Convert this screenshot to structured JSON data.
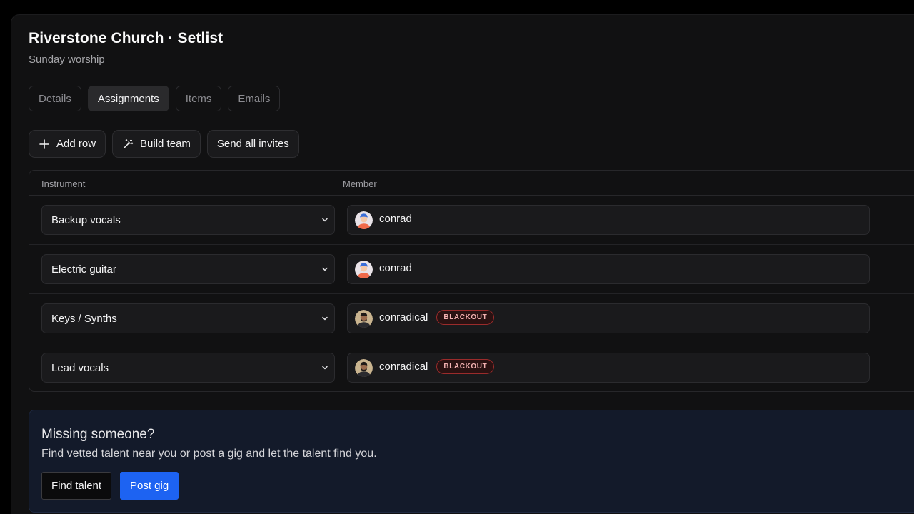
{
  "header": {
    "title": "Riverstone Church · Setlist",
    "subtitle": "Sunday worship"
  },
  "tabs": [
    {
      "label": "Details",
      "active": false
    },
    {
      "label": "Assignments",
      "active": true
    },
    {
      "label": "Items",
      "active": false
    },
    {
      "label": "Emails",
      "active": false
    }
  ],
  "actions": {
    "add_row": "Add row",
    "build_team": "Build team",
    "send_invites": "Send all invites"
  },
  "table": {
    "columns": [
      "Instrument",
      "Member"
    ],
    "rows": [
      {
        "instrument": "Backup vocals",
        "member": "conrad",
        "badge": ""
      },
      {
        "instrument": "Electric guitar",
        "member": "conrad",
        "badge": ""
      },
      {
        "instrument": "Keys / Synths",
        "member": "conradical",
        "badge": "BLACKOUT"
      },
      {
        "instrument": "Lead vocals",
        "member": "conradical",
        "badge": "BLACKOUT"
      }
    ]
  },
  "callout": {
    "title": "Missing someone?",
    "text": "Find vetted talent near you or post a gig and let the talent find you.",
    "find_label": "Find talent",
    "post_label": "Post gig"
  },
  "colors": {
    "accent": "#1d63f2",
    "badge_border": "#9b2b2b",
    "badge_text": "#f3b2b2"
  }
}
